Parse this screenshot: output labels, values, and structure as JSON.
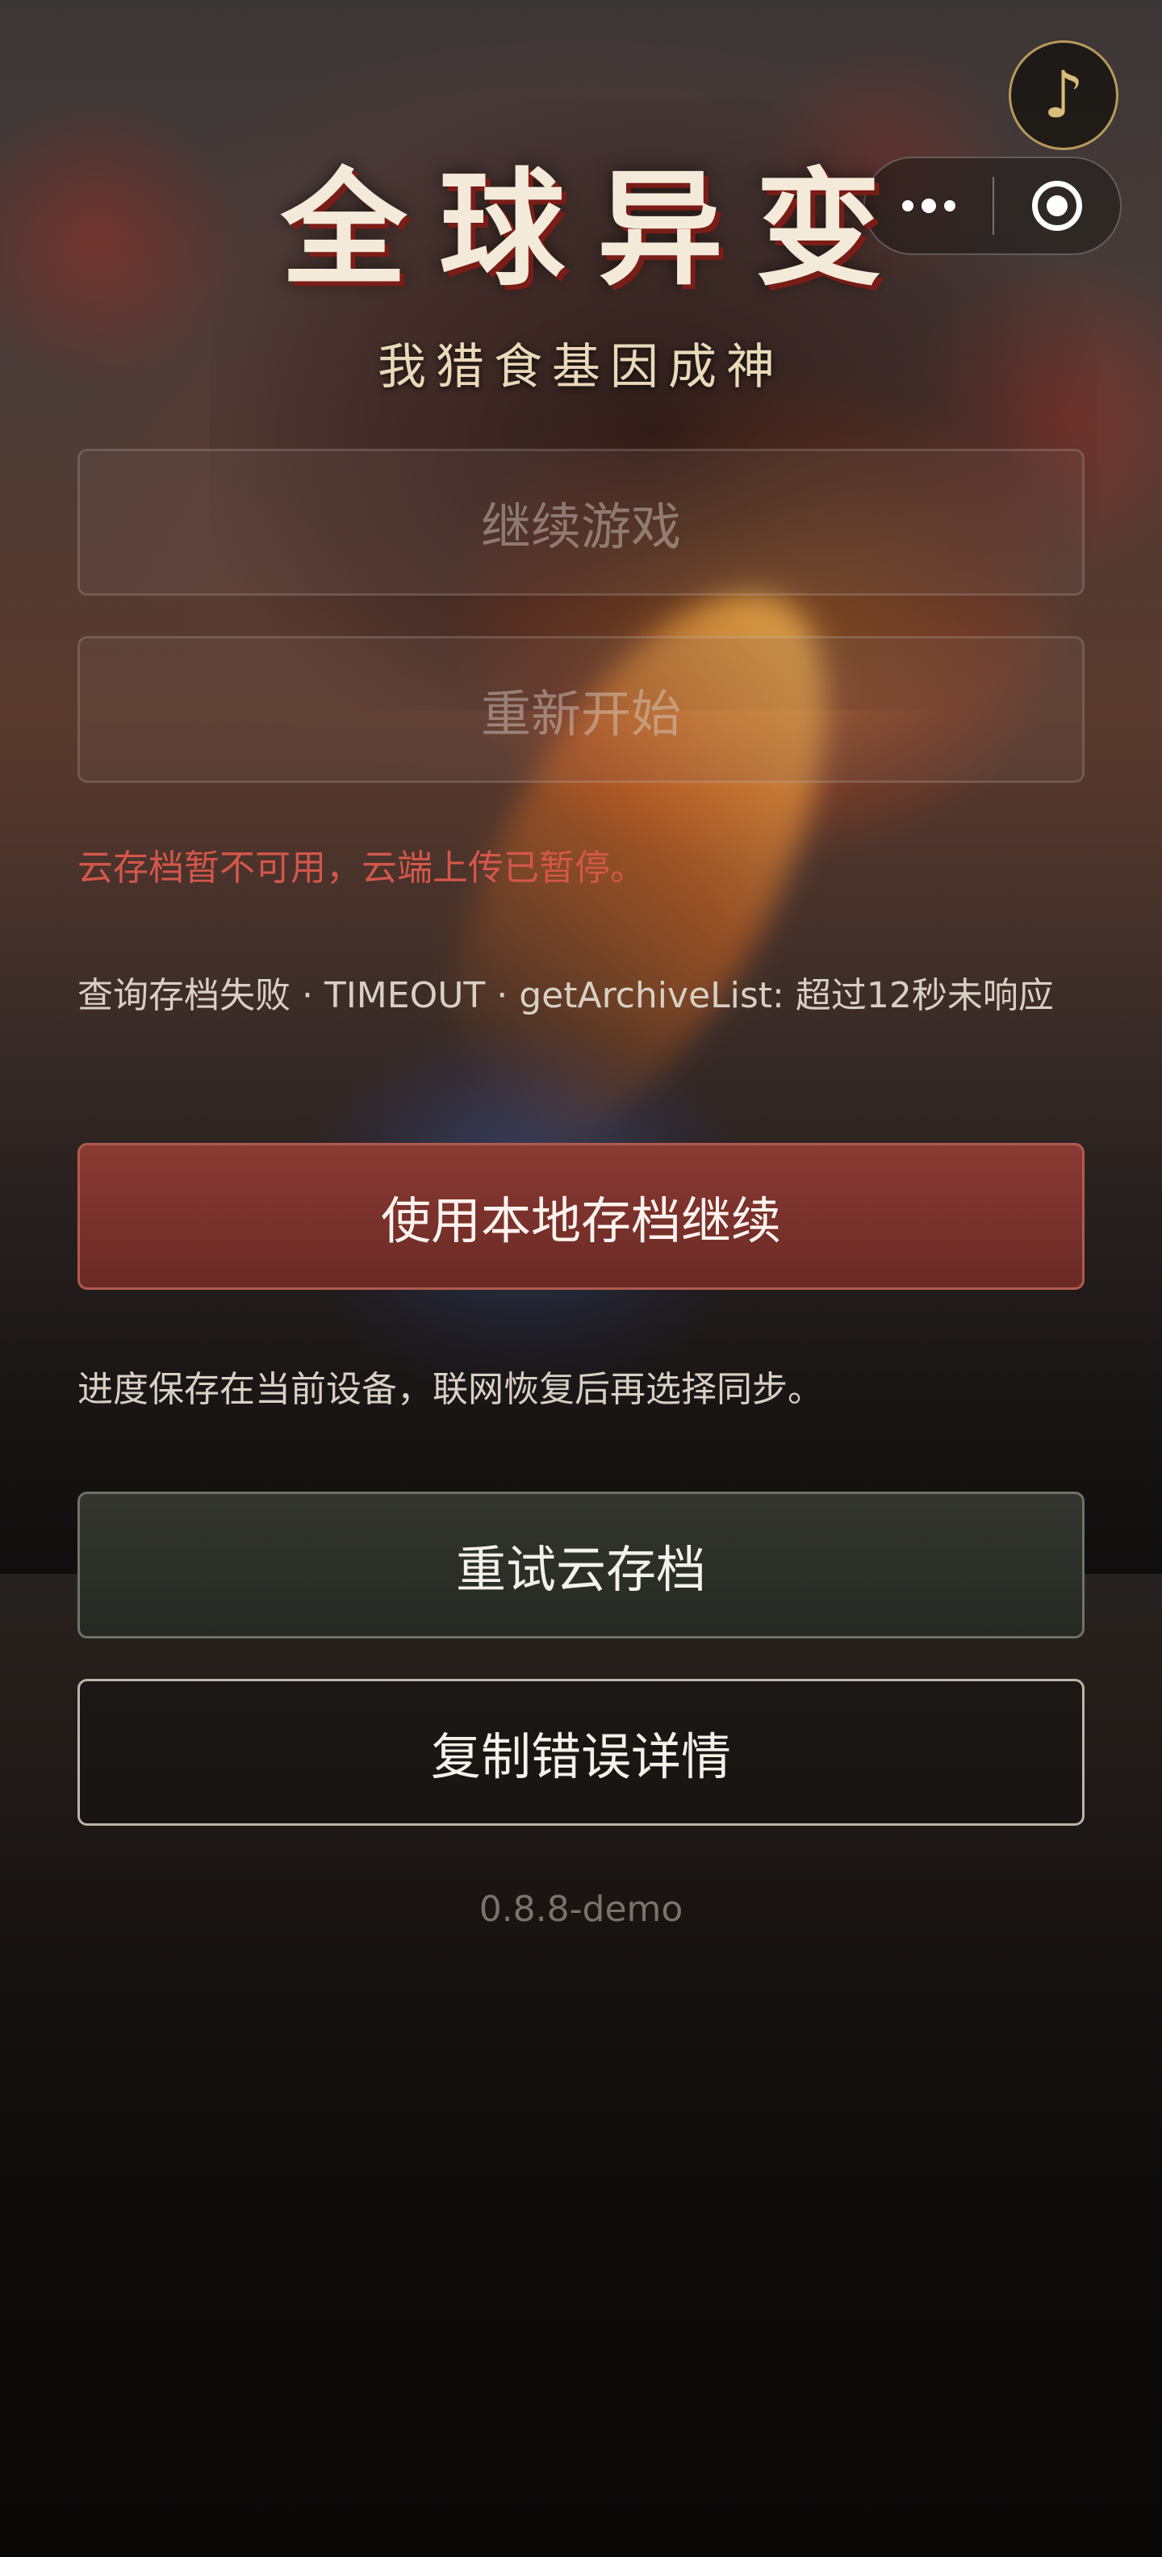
{
  "header": {
    "title": "全球异变",
    "subtitle": "我猎食基因成神"
  },
  "capsule": {
    "more_icon": "more-dots-icon",
    "close_icon": "record-close-icon"
  },
  "music": {
    "icon": "♪"
  },
  "menu": {
    "continue_label": "继续游戏",
    "restart_label": "重新开始"
  },
  "cloud": {
    "error_message": "云存档暂不可用，云端上传已暂停。",
    "error_detail": "查询存档失败 · TIMEOUT · getArchiveList: 超过12秒未响应",
    "use_local_label": "使用本地存档继续",
    "hint": "进度保存在当前设备，联网恢复后再选择同步。",
    "retry_label": "重试云存档",
    "copy_label": "复制错误详情"
  },
  "footer": {
    "version": "0.8.8-demo"
  },
  "colors": {
    "primary": "#7a302a",
    "error": "#d4574a",
    "title_shadow": "#7a1d16"
  }
}
